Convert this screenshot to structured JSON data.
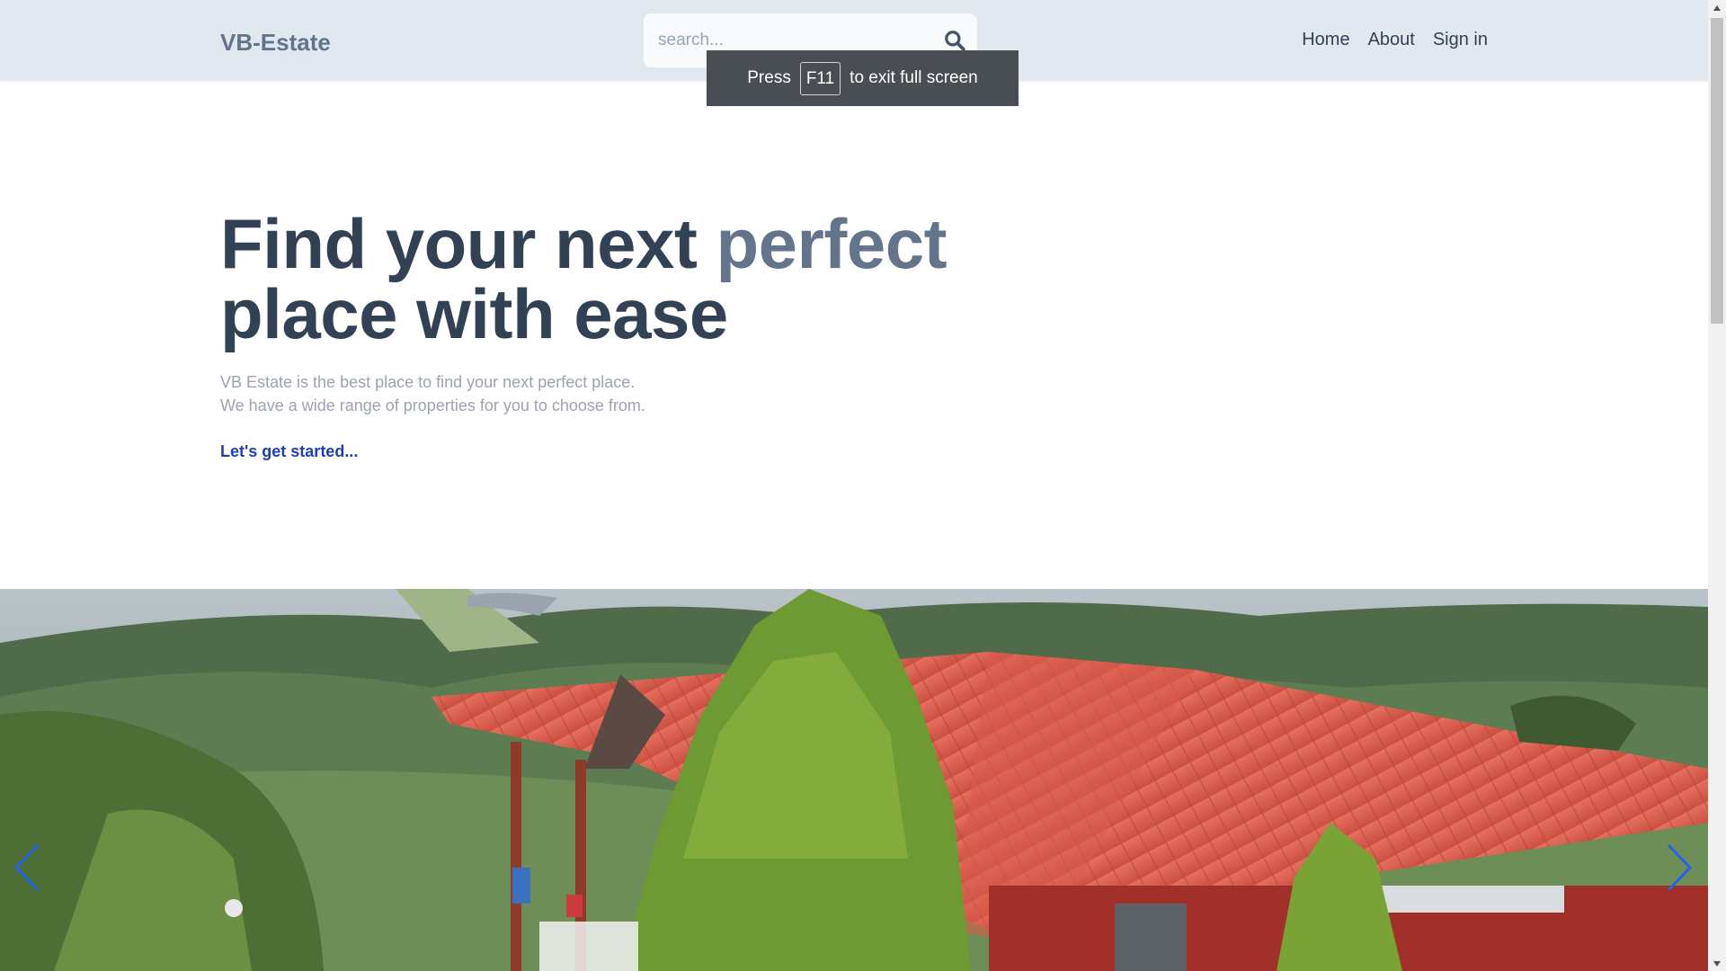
{
  "header": {
    "logo": "VB-Estate",
    "search": {
      "placeholder": "search...",
      "value": ""
    },
    "nav": [
      "Home",
      "About",
      "Sign in"
    ]
  },
  "fullscreen_toast": {
    "prefix": "Press",
    "key": "F11",
    "suffix": "to exit full screen"
  },
  "hero": {
    "title_part1": "Find your next",
    "title_accent": "perfect",
    "title_part2": "place with ease",
    "description_line1": "VB Estate is the best place to find your next perfect place.",
    "description_line2": "We have a wide range of properties for you to choose from.",
    "cta": "Let's get started..."
  },
  "carousel": {
    "prev_icon": "chevron-left-icon",
    "next_icon": "chevron-right-icon",
    "image": "house-with-red-roof-photo"
  },
  "colors": {
    "header_bg": "#e2e8f0",
    "title": "#334155",
    "accent": "#64748b",
    "cta": "#1e40af",
    "arrow": "#2563eb"
  }
}
